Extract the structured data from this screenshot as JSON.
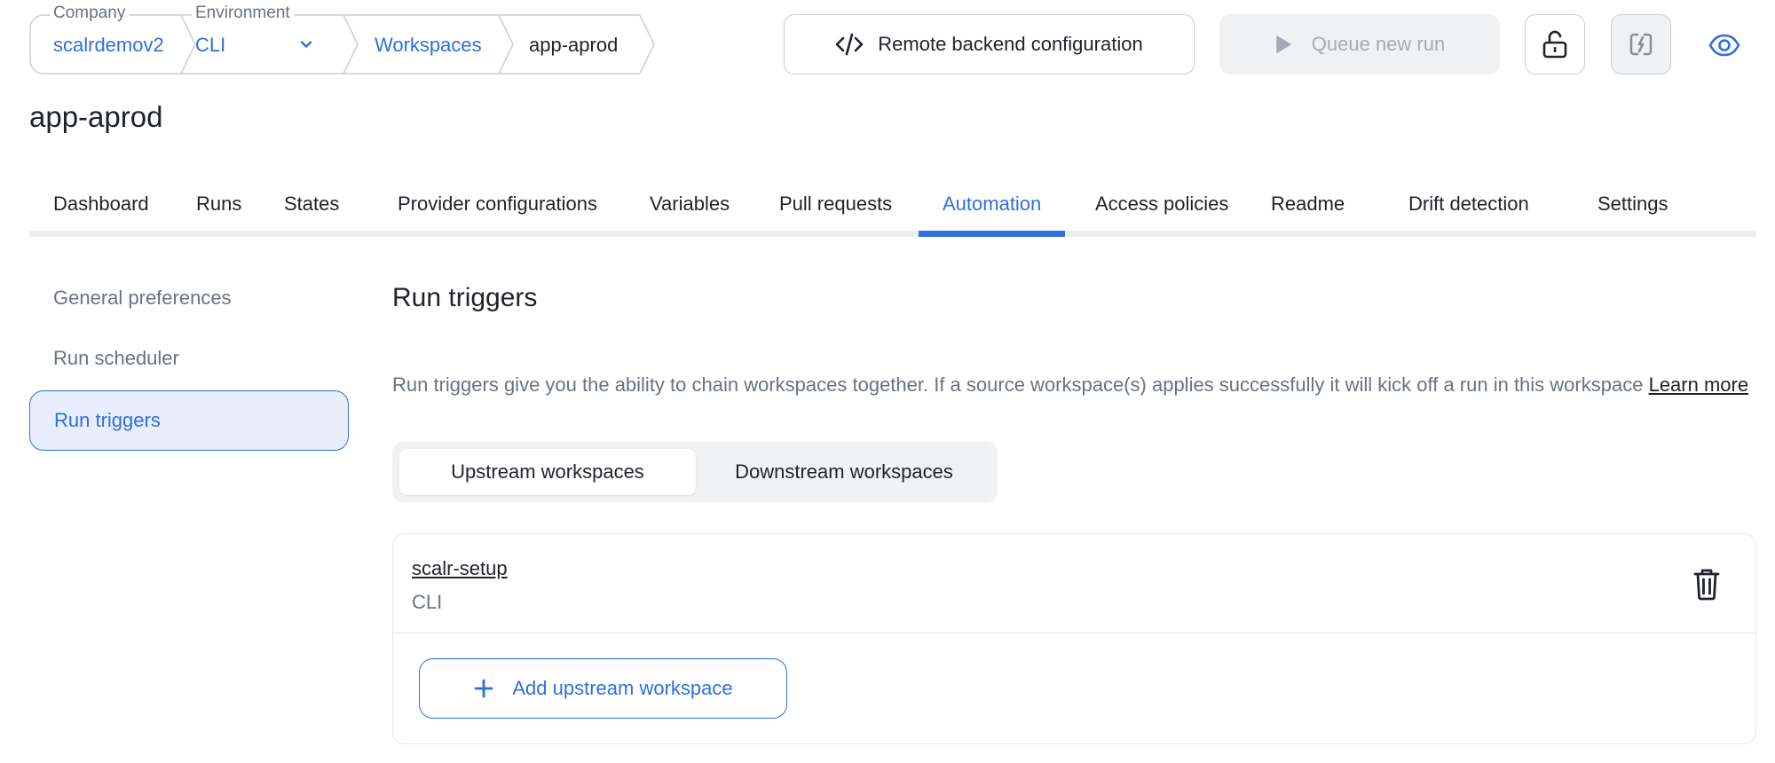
{
  "breadcrumb": {
    "company": {
      "legend": "Company",
      "value": "scalrdemov2"
    },
    "environment": {
      "legend": "Environment",
      "value": "CLI"
    },
    "workspaces": "Workspaces",
    "current": "app-aprod"
  },
  "toolbar": {
    "remote_backend_label": "Remote backend configuration",
    "queue_run_label": "Queue new run"
  },
  "page_title": "app-aprod",
  "tabs": [
    {
      "label": "Dashboard"
    },
    {
      "label": "Runs"
    },
    {
      "label": "States"
    },
    {
      "label": "Provider configurations"
    },
    {
      "label": "Variables"
    },
    {
      "label": "Pull requests"
    },
    {
      "label": "Automation",
      "active": true
    },
    {
      "label": "Access policies"
    },
    {
      "label": "Readme"
    },
    {
      "label": "Drift detection"
    },
    {
      "label": "Settings"
    }
  ],
  "sidebar": {
    "items": [
      {
        "label": "General preferences"
      },
      {
        "label": "Run scheduler"
      },
      {
        "label": "Run triggers",
        "active": true
      }
    ]
  },
  "section": {
    "title": "Run triggers",
    "description": "Run triggers give you the ability to chain workspaces together. If a source workspace(s) applies successfully it will kick off a run in this workspace",
    "learn_more": "Learn more"
  },
  "segmented": {
    "upstream": "Upstream workspaces",
    "downstream": "Downstream workspaces",
    "active": "upstream"
  },
  "upstream_list": [
    {
      "name": "scalr-setup",
      "environment": "CLI"
    }
  ],
  "add_button_label": "Add upstream workspace",
  "colors": {
    "accent": "#2f6fde",
    "muted_text": "#6b7280",
    "active_bg": "#e8eefb",
    "disabled_bg": "#f0f1f3"
  },
  "icons": {
    "remote_backend": "code-icon",
    "queue_run": "play-icon",
    "lock": "unlock-icon",
    "drift": "drift-icon",
    "watch": "eye-icon",
    "delete": "trash-icon",
    "add": "plus-icon",
    "environment_dropdown": "chevron-down-icon"
  }
}
